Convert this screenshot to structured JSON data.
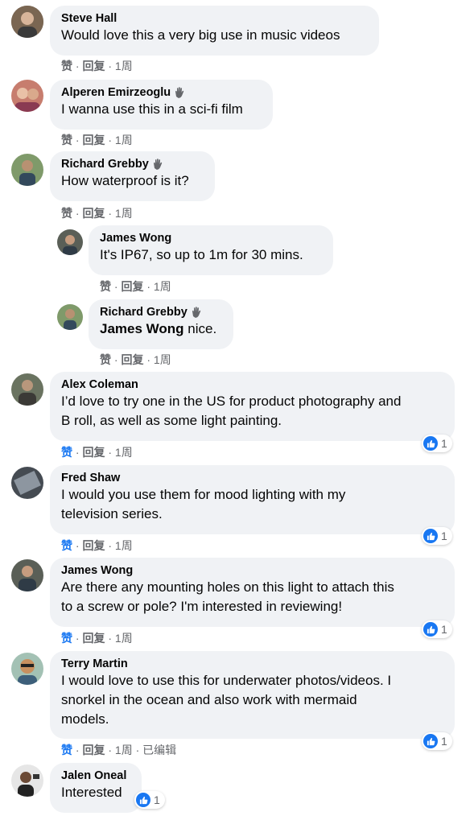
{
  "actions": {
    "like": "赞",
    "reply": "回复",
    "dot": " · "
  },
  "comments": [
    {
      "author": "Steve Hall",
      "text": "Would love this a very big use in music videos",
      "time": "1周",
      "badge": false
    },
    {
      "author": "Alperen Emirzeoglu",
      "text": "I wanna use this in a sci-fi film",
      "time": "1周",
      "badge": true
    },
    {
      "author": "Richard Grebby",
      "text": "How waterproof is it?",
      "time": "1周",
      "badge": true
    },
    {
      "author": "James Wong",
      "text": "It's IP67, so up to 1m for 30 mins.",
      "time": "1周",
      "badge": false
    },
    {
      "author": "Richard Grebby",
      "mention": "James Wong",
      "text": " nice.",
      "time": "1周",
      "badge": true
    },
    {
      "author": "Alex Coleman",
      "text_line1": "I’d love to try one in the US for product photography and",
      "text_line2": "B roll, as well as some light painting.",
      "time": "1周",
      "reactions": "1"
    },
    {
      "author": "Fred Shaw",
      "text_line1": "I would you use them for mood lighting with my",
      "text_line2": "television series.",
      "time": "1周",
      "reactions": "1"
    },
    {
      "author": "James Wong",
      "text_line1": "Are there any mounting holes on this light to attach this",
      "text_line2": "to a screw or pole? I'm interested in reviewing!",
      "time": "1周",
      "reactions": "1"
    },
    {
      "author": "Terry Martin",
      "text_line1": "I would love to use this for underwater photos/videos. I",
      "text_line2": "snorkel in the ocean and also work with mermaid",
      "text_line3": "models.",
      "time": "1周",
      "edited": "已编辑",
      "reactions": "1"
    },
    {
      "author": "Jalen Oneal",
      "text": "Interested",
      "reactions": "1"
    }
  ],
  "colors": {
    "bubble": "#f0f2f5",
    "liked": "#1877f2",
    "meta": "#65676b"
  },
  "icons": {
    "badge": "waving-hand-icon",
    "reaction": "like-reaction-icon"
  }
}
